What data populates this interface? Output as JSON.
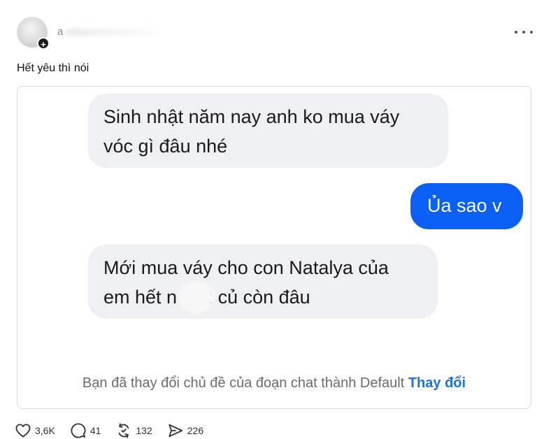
{
  "author": {
    "username": "a"
  },
  "post": {
    "caption": "Hết yêu thì nói"
  },
  "chat": {
    "messages": [
      {
        "side": "incoming",
        "line1": "Sinh nhật năm nay anh ko mua váy",
        "line2": "vóc gì đâu nhé"
      },
      {
        "side": "outgoing",
        "line1": "Ủa sao v"
      },
      {
        "side": "incoming",
        "line1": "Mới mua váy cho con Natalya của",
        "line2_a": "em hết n",
        "line2_b": "2 củ còn đâu"
      }
    ],
    "system_text": "Bạn đã thay đổi chủ đề của đoạn chat thành Default",
    "system_link": "Thay đổi"
  },
  "actions": {
    "likes": "3,6K",
    "replies": "41",
    "reposts": "132",
    "shares": "226"
  },
  "colors": {
    "incoming_bubble": "#eff0f3",
    "outgoing_bubble": "#0a60f5",
    "link": "#1a73e8"
  },
  "icons": [
    "plus-icon",
    "more-icon",
    "heart-icon",
    "comment-icon",
    "repost-icon",
    "share-icon"
  ]
}
